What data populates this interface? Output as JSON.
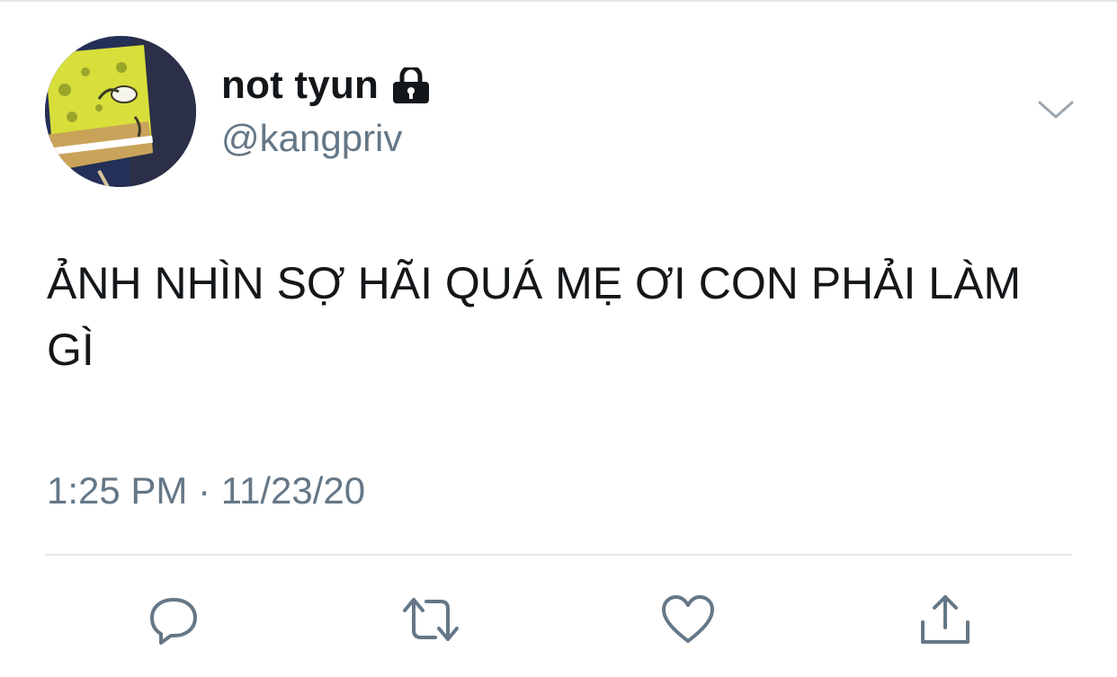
{
  "tweet": {
    "author": {
      "display_name": "not tyun",
      "handle": "@kangpriv",
      "avatar": "spongebob-avatar",
      "protected_icon": "lock-icon"
    },
    "menu_icon": "chevron-down-icon",
    "text": "ẢNH NHÌN SỢ HÃI QUÁ MẸ ƠI CON PHẢI LÀM GÌ",
    "timestamp": "1:25 PM · 11/23/20"
  },
  "actions": [
    {
      "name": "reply",
      "icon": "reply-icon"
    },
    {
      "name": "retweet",
      "icon": "retweet-icon"
    },
    {
      "name": "like",
      "icon": "heart-icon"
    },
    {
      "name": "share",
      "icon": "share-icon"
    }
  ],
  "colors": {
    "text_primary": "#14171a",
    "text_secondary": "#657786",
    "icon": "#657786",
    "divider": "#e1e8ed",
    "background": "#ffffff"
  }
}
